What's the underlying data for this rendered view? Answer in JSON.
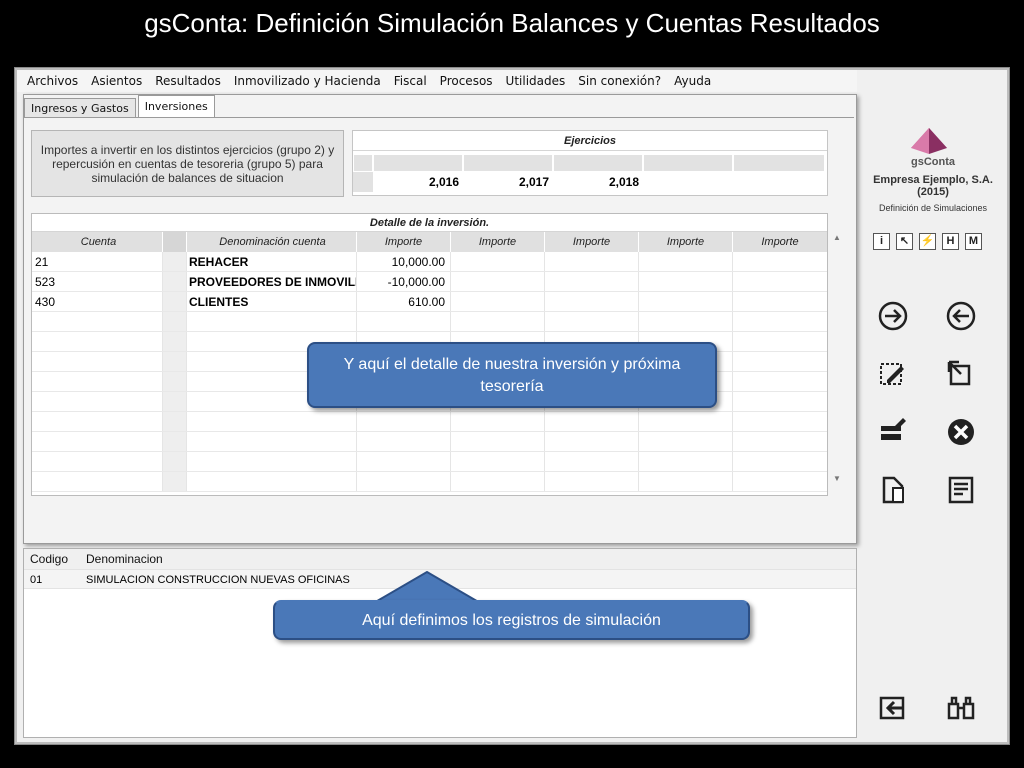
{
  "slide_title": "gsConta: Definición Simulación Balances y Cuentas Resultados",
  "menu": [
    "Archivos",
    "Asientos",
    "Resultados",
    "Inmovilizado y Hacienda",
    "Fiscal",
    "Procesos",
    "Utilidades",
    "Sin conexión?",
    "Ayuda"
  ],
  "tabs": [
    "Ingresos y Gastos",
    "Inversiones"
  ],
  "description": "Importes a invertir en los distintos ejercicios (grupo 2) y repercusión en cuentas de tesoreria (grupo 5) para simulación de balances de situacion",
  "ejercicios": {
    "title": "Ejercicios",
    "years": [
      "2,016",
      "2,017",
      "2,018",
      ""
    ]
  },
  "detalle": {
    "title": "Detalle de la inversión.",
    "headers": [
      "Cuenta",
      "Denominación cuenta",
      "Importe",
      "Importe",
      "Importe",
      "Importe",
      "Importe"
    ],
    "rows": [
      [
        "21",
        "REHACER",
        "10,000.00",
        "",
        "",
        "",
        ""
      ],
      [
        "523",
        "PROVEEDORES DE INMOVILIZ",
        "-10,000.00",
        "",
        "",
        "",
        ""
      ],
      [
        "430",
        "CLIENTES",
        "610.00",
        "",
        "",
        "",
        ""
      ]
    ]
  },
  "registros": {
    "headers": [
      "Codigo",
      "Denominacion"
    ],
    "rows": [
      [
        "01",
        "SIMULACION CONSTRUCCION NUEVAS OFICINAS"
      ]
    ]
  },
  "sidebar": {
    "app_name": "gsConta",
    "company": "Empresa Ejemplo, S.A.",
    "year": "(2015)",
    "section": "Definición de Simulaciones",
    "small_icons": [
      "i",
      "↖",
      "⚡",
      "H",
      "M"
    ]
  },
  "callouts": {
    "detalle": "Y aquí el detalle de nuestra inversión y próxima tesorería",
    "registros": "Aquí definimos los registros de simulación"
  },
  "colors": {
    "callout": "#4a78b8",
    "logo": "#c0508a"
  }
}
